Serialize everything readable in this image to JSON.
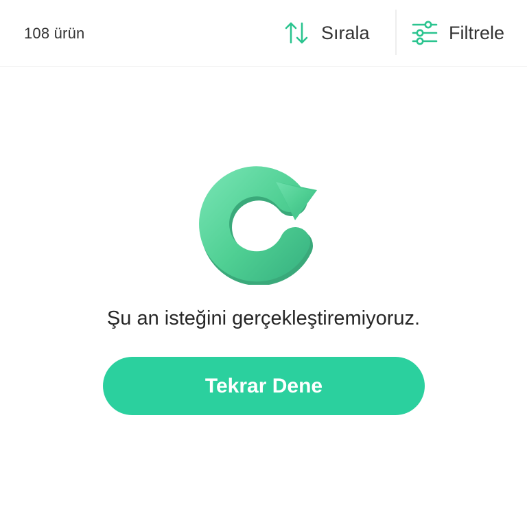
{
  "header": {
    "product_count": "108 ürün",
    "sort_label": "Sırala",
    "filter_label": "Filtrele"
  },
  "error_state": {
    "icon": "refresh-icon",
    "message": "Şu an isteğini gerçekleştiremiyoruz.",
    "retry_label": "Tekrar Dene"
  },
  "colors": {
    "accent": "#2bd09e",
    "icon_green": "#3ccf93"
  }
}
